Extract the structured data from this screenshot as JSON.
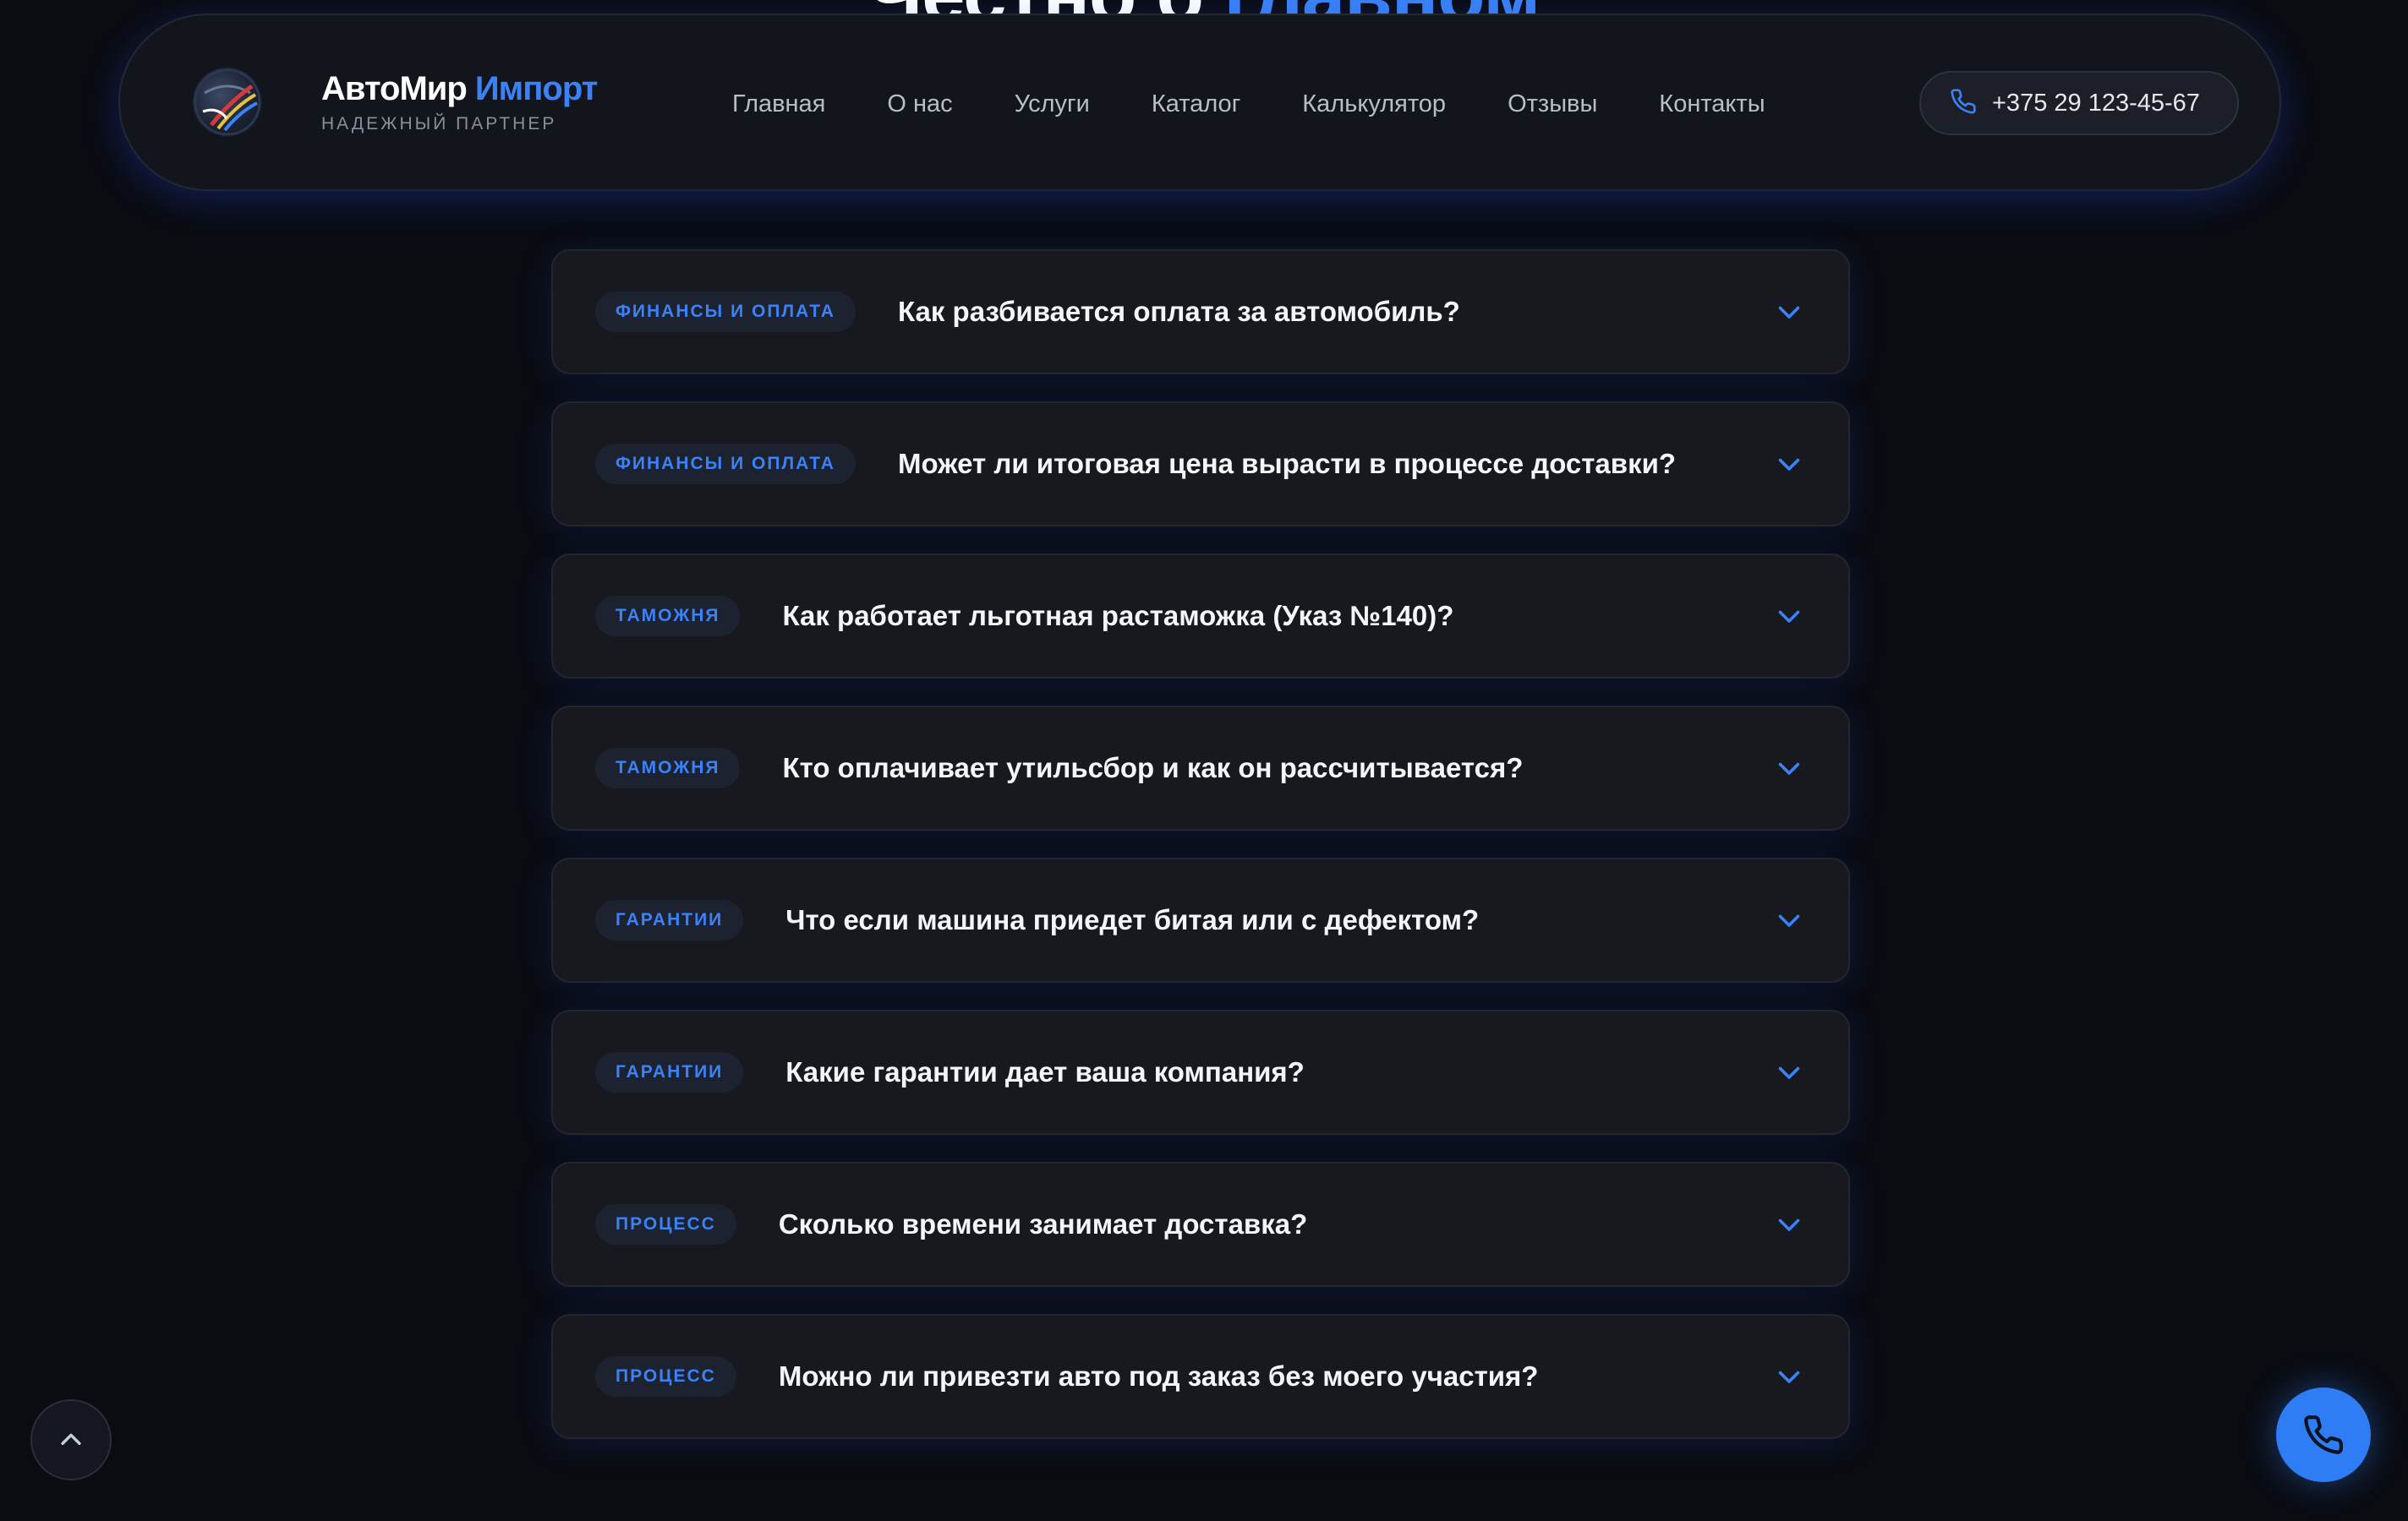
{
  "section_heading": {
    "part1": "Честно о",
    "part2": "главном"
  },
  "header": {
    "brand_part1": "АвтоМир",
    "brand_part2": "Импорт",
    "tagline": "НАДЕЖНЫЙ ПАРТНЕР",
    "nav": [
      "Главная",
      "О нас",
      "Услуги",
      "Каталог",
      "Калькулятор",
      "Отзывы",
      "Контакты"
    ],
    "phone": "+375 29 123-45-67"
  },
  "faq": [
    {
      "tag": "ФИНАНСЫ И ОПЛАТА",
      "question": "Как разбивается оплата за автомобиль?"
    },
    {
      "tag": "ФИНАНСЫ И ОПЛАТА",
      "question": "Может ли итоговая цена вырасти в процессе доставки?"
    },
    {
      "tag": "ТАМОЖНЯ",
      "question": "Как работает льготная растаможка (Указ №140)?"
    },
    {
      "tag": "ТАМОЖНЯ",
      "question": "Кто оплачивает утильсбор и как он рассчитывается?"
    },
    {
      "tag": "ГАРАНТИИ",
      "question": "Что если машина приедет битая или с дефектом?"
    },
    {
      "tag": "ГАРАНТИИ",
      "question": "Какие гарантии дает ваша компания?"
    },
    {
      "tag": "ПРОЦЕСС",
      "question": "Сколько времени занимает доставка?"
    },
    {
      "tag": "ПРОЦЕСС",
      "question": "Можно ли привезти авто под заказ без моего участия?"
    }
  ],
  "icons": {
    "logo": "globe-logo-icon",
    "phone": "phone-icon",
    "chevron": "chevron-down-icon",
    "scroll_top": "chevron-up-icon",
    "call": "phone-icon"
  },
  "colors": {
    "accent": "#3b82f6",
    "background": "#0a0c12",
    "card": "#17191f",
    "tag_bg": "#1d2230",
    "fab": "#2f7df5"
  }
}
